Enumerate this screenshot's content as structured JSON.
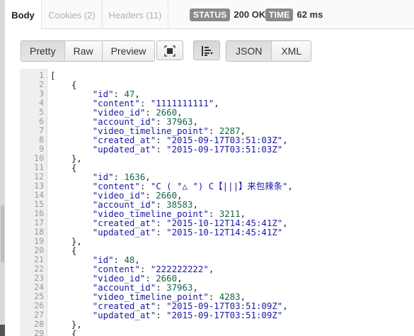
{
  "tabs": [
    {
      "label": "Body",
      "active": true
    },
    {
      "label": "Cookies (2)",
      "active": false
    },
    {
      "label": "Headers (11)",
      "active": false
    }
  ],
  "status": {
    "label": "STATUS",
    "value": "200 OK"
  },
  "time": {
    "label": "TIME",
    "value": "62 ms"
  },
  "view_modes": [
    {
      "label": "Pretty",
      "selected": true
    },
    {
      "label": "Raw",
      "selected": false
    },
    {
      "label": "Preview",
      "selected": false
    }
  ],
  "toolbar_icons": {
    "expand": "fullscreen-icon",
    "wrap": "wrap-lines-icon"
  },
  "formats": [
    {
      "label": "JSON",
      "selected": true
    },
    {
      "label": "XML",
      "selected": false
    }
  ],
  "code_lines": [
    {
      "n": "1",
      "parts": [
        [
          "pun",
          "["
        ]
      ]
    },
    {
      "n": "2",
      "parts": [
        [
          "pun",
          "    {"
        ]
      ]
    },
    {
      "n": "3",
      "parts": [
        [
          "pun",
          "        "
        ],
        [
          "key",
          "\"id\""
        ],
        [
          "pun",
          ": "
        ],
        [
          "num",
          "47"
        ],
        [
          "pun",
          ","
        ]
      ]
    },
    {
      "n": "4",
      "parts": [
        [
          "pun",
          "        "
        ],
        [
          "key",
          "\"content\""
        ],
        [
          "pun",
          ": "
        ],
        [
          "str",
          "\"1111111111\""
        ],
        [
          "pun",
          ","
        ]
      ]
    },
    {
      "n": "5",
      "parts": [
        [
          "pun",
          "        "
        ],
        [
          "key",
          "\"video_id\""
        ],
        [
          "pun",
          ": "
        ],
        [
          "num",
          "2660"
        ],
        [
          "pun",
          ","
        ]
      ]
    },
    {
      "n": "6",
      "parts": [
        [
          "pun",
          "        "
        ],
        [
          "key",
          "\"account_id\""
        ],
        [
          "pun",
          ": "
        ],
        [
          "num",
          "37963"
        ],
        [
          "pun",
          ","
        ]
      ]
    },
    {
      "n": "7",
      "parts": [
        [
          "pun",
          "        "
        ],
        [
          "key",
          "\"video_timeline_point\""
        ],
        [
          "pun",
          ": "
        ],
        [
          "num",
          "2287"
        ],
        [
          "pun",
          ","
        ]
      ]
    },
    {
      "n": "8",
      "parts": [
        [
          "pun",
          "        "
        ],
        [
          "key",
          "\"created_at\""
        ],
        [
          "pun",
          ": "
        ],
        [
          "str",
          "\"2015-09-17T03:51:03Z\""
        ],
        [
          "pun",
          ","
        ]
      ]
    },
    {
      "n": "9",
      "parts": [
        [
          "pun",
          "        "
        ],
        [
          "key",
          "\"updated_at\""
        ],
        [
          "pun",
          ": "
        ],
        [
          "str",
          "\"2015-09-17T03:51:03Z\""
        ]
      ]
    },
    {
      "n": "10",
      "parts": [
        [
          "pun",
          "    },"
        ]
      ]
    },
    {
      "n": "11",
      "parts": [
        [
          "pun",
          "    {"
        ]
      ]
    },
    {
      "n": "12",
      "parts": [
        [
          "pun",
          "        "
        ],
        [
          "key",
          "\"id\""
        ],
        [
          "pun",
          ": "
        ],
        [
          "num",
          "1636"
        ],
        [
          "pun",
          ","
        ]
      ]
    },
    {
      "n": "13",
      "parts": [
        [
          "pun",
          "        "
        ],
        [
          "key",
          "\"content\""
        ],
        [
          "pun",
          ": "
        ],
        [
          "str",
          "\"C ( °△ °) C【|||】来包辣条\""
        ],
        [
          "pun",
          ","
        ]
      ]
    },
    {
      "n": "14",
      "parts": [
        [
          "pun",
          "        "
        ],
        [
          "key",
          "\"video_id\""
        ],
        [
          "pun",
          ": "
        ],
        [
          "num",
          "2660"
        ],
        [
          "pun",
          ","
        ]
      ]
    },
    {
      "n": "15",
      "parts": [
        [
          "pun",
          "        "
        ],
        [
          "key",
          "\"account_id\""
        ],
        [
          "pun",
          ": "
        ],
        [
          "num",
          "38583"
        ],
        [
          "pun",
          ","
        ]
      ]
    },
    {
      "n": "16",
      "parts": [
        [
          "pun",
          "        "
        ],
        [
          "key",
          "\"video_timeline_point\""
        ],
        [
          "pun",
          ": "
        ],
        [
          "num",
          "3211"
        ],
        [
          "pun",
          ","
        ]
      ]
    },
    {
      "n": "17",
      "parts": [
        [
          "pun",
          "        "
        ],
        [
          "key",
          "\"created_at\""
        ],
        [
          "pun",
          ": "
        ],
        [
          "str",
          "\"2015-10-12T14:45:41Z\""
        ],
        [
          "pun",
          ","
        ]
      ]
    },
    {
      "n": "18",
      "parts": [
        [
          "pun",
          "        "
        ],
        [
          "key",
          "\"updated_at\""
        ],
        [
          "pun",
          ": "
        ],
        [
          "str",
          "\"2015-10-12T14:45:41Z\""
        ]
      ]
    },
    {
      "n": "19",
      "parts": [
        [
          "pun",
          "    },"
        ]
      ]
    },
    {
      "n": "20",
      "parts": [
        [
          "pun",
          "    {"
        ]
      ]
    },
    {
      "n": "21",
      "parts": [
        [
          "pun",
          "        "
        ],
        [
          "key",
          "\"id\""
        ],
        [
          "pun",
          ": "
        ],
        [
          "num",
          "48"
        ],
        [
          "pun",
          ","
        ]
      ]
    },
    {
      "n": "22",
      "parts": [
        [
          "pun",
          "        "
        ],
        [
          "key",
          "\"content\""
        ],
        [
          "pun",
          ": "
        ],
        [
          "str",
          "\"222222222\""
        ],
        [
          "pun",
          ","
        ]
      ]
    },
    {
      "n": "23",
      "parts": [
        [
          "pun",
          "        "
        ],
        [
          "key",
          "\"video_id\""
        ],
        [
          "pun",
          ": "
        ],
        [
          "num",
          "2660"
        ],
        [
          "pun",
          ","
        ]
      ]
    },
    {
      "n": "24",
      "parts": [
        [
          "pun",
          "        "
        ],
        [
          "key",
          "\"account_id\""
        ],
        [
          "pun",
          ": "
        ],
        [
          "num",
          "37963"
        ],
        [
          "pun",
          ","
        ]
      ]
    },
    {
      "n": "25",
      "parts": [
        [
          "pun",
          "        "
        ],
        [
          "key",
          "\"video_timeline_point\""
        ],
        [
          "pun",
          ": "
        ],
        [
          "num",
          "4283"
        ],
        [
          "pun",
          ","
        ]
      ]
    },
    {
      "n": "26",
      "parts": [
        [
          "pun",
          "        "
        ],
        [
          "key",
          "\"created_at\""
        ],
        [
          "pun",
          ": "
        ],
        [
          "str",
          "\"2015-09-17T03:51:09Z\""
        ],
        [
          "pun",
          ","
        ]
      ]
    },
    {
      "n": "27",
      "parts": [
        [
          "pun",
          "        "
        ],
        [
          "key",
          "\"updated_at\""
        ],
        [
          "pun",
          ": "
        ],
        [
          "str",
          "\"2015-09-17T03:51:09Z\""
        ]
      ]
    },
    {
      "n": "28",
      "parts": [
        [
          "pun",
          "    },"
        ]
      ]
    },
    {
      "n": "29",
      "parts": [
        [
          "pun",
          "    {"
        ]
      ]
    }
  ]
}
